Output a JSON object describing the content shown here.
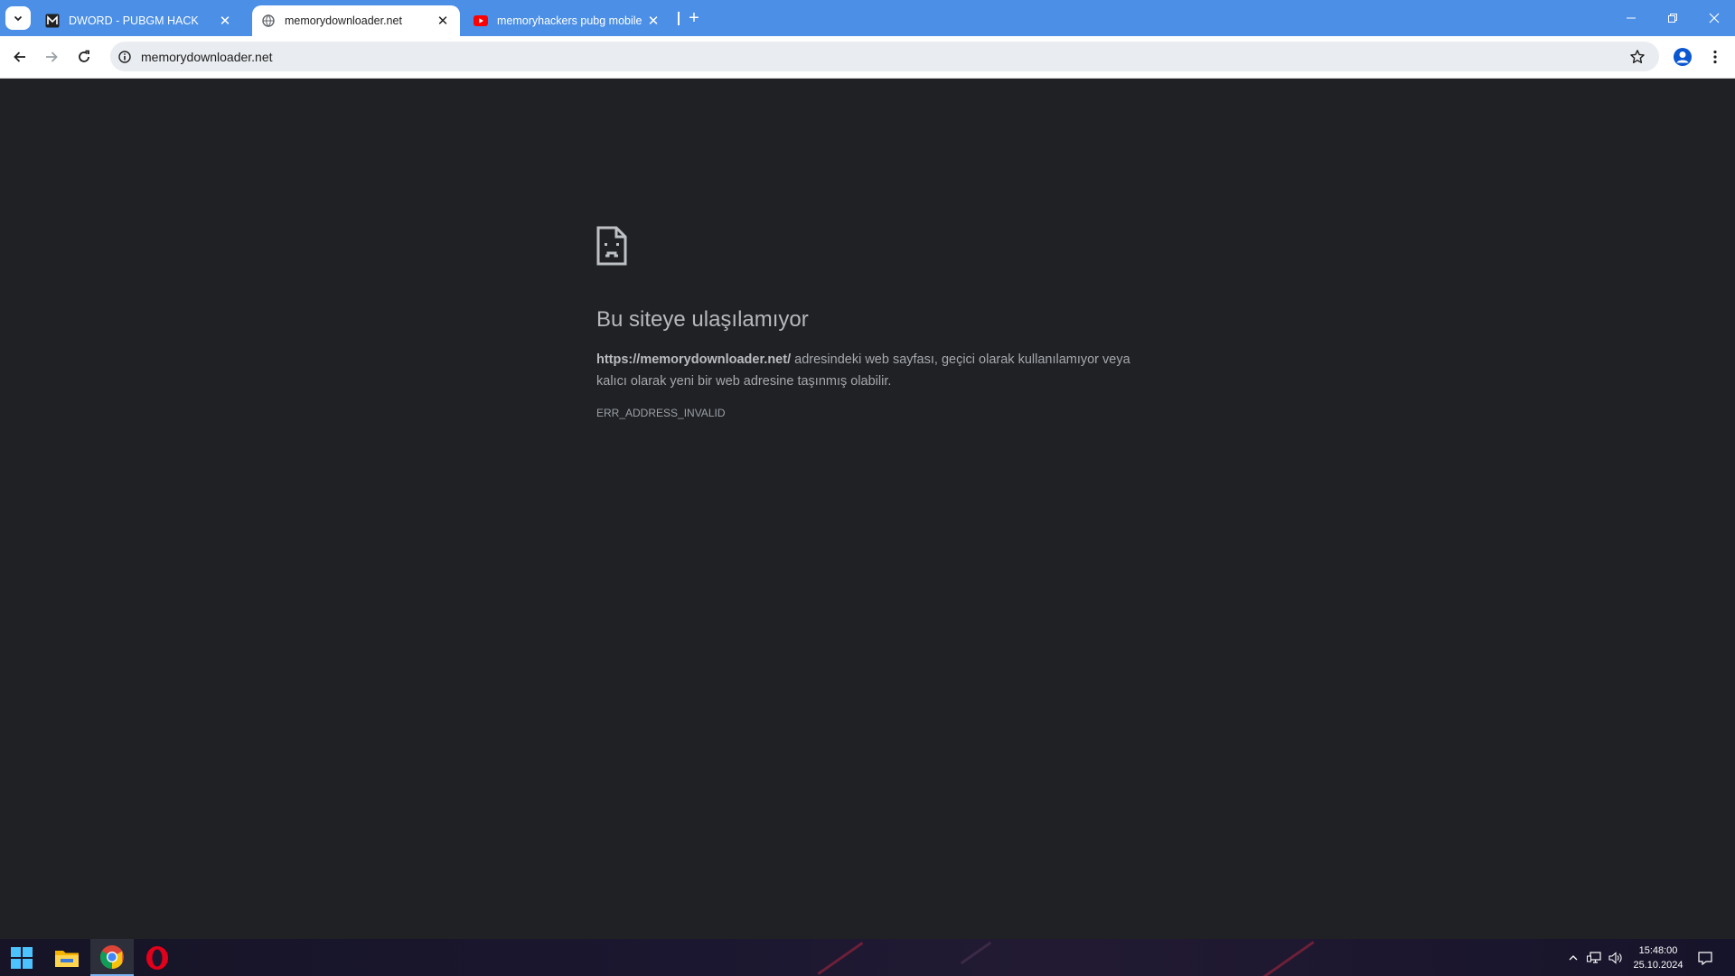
{
  "tabs": [
    {
      "title": "DWORD - PUBGM HACK",
      "favicon": "m-logo-icon",
      "active": false
    },
    {
      "title": "memorydownloader.net",
      "favicon": "globe-icon",
      "active": true
    },
    {
      "title": "memoryhackers pubg mobile h",
      "favicon": "youtube-icon",
      "active": false
    }
  ],
  "new_tab_label": "+",
  "omnibox": {
    "url": "memorydownloader.net"
  },
  "error": {
    "title": "Bu siteye ulaşılamıyor",
    "url_bold": "https://memorydownloader.net/",
    "desc_rest": " adresindeki web sayfası, geçici olarak kullanılamıyor veya kalıcı olarak yeni bir web adresine taşınmış olabilir.",
    "code": "ERR_ADDRESS_INVALID"
  },
  "clock": {
    "time": "15:48:00",
    "date": "25.10.2024"
  },
  "colors": {
    "tabstrip": "#4b8fe6",
    "page_bg": "#202124",
    "youtube_red": "#ff0000",
    "opera_red": "#e3001b"
  }
}
